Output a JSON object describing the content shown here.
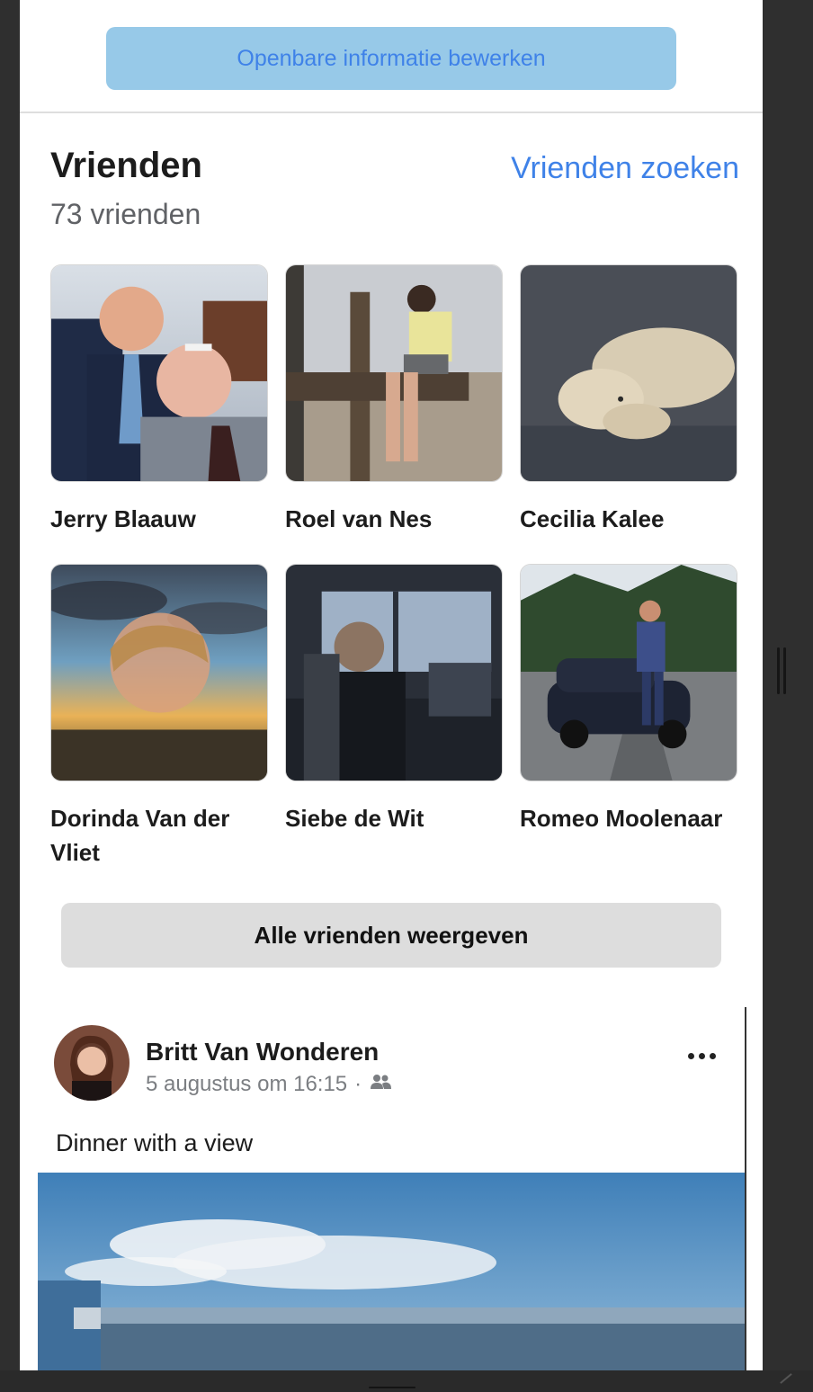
{
  "profile": {
    "edit_public_info_label": "Openbare informatie bewerken"
  },
  "friends": {
    "title": "Vrienden",
    "count_text": "73 vrienden",
    "find_friends_label": "Vrienden zoeken",
    "items": [
      {
        "name": "Jerry Blaauw"
      },
      {
        "name": "Roel van Nes"
      },
      {
        "name": "Cecilia Kalee"
      },
      {
        "name": "Dorinda Van der Vliet"
      },
      {
        "name": "Siebe de Wit"
      },
      {
        "name": "Romeo Moolenaar"
      }
    ],
    "all_friends_label": "Alle vrienden weergeven"
  },
  "post": {
    "author": "Britt Van Wonderen",
    "timestamp": "5 augustus om 16:15",
    "separator": "·",
    "audience_icon": "friends-icon",
    "more_icon": "more-dots-icon",
    "text": "Dinner with a view"
  },
  "colors": {
    "accent_blue": "#3f82e8",
    "edit_button_bg": "#97c9e8",
    "secondary_button_bg": "#dddddd"
  }
}
